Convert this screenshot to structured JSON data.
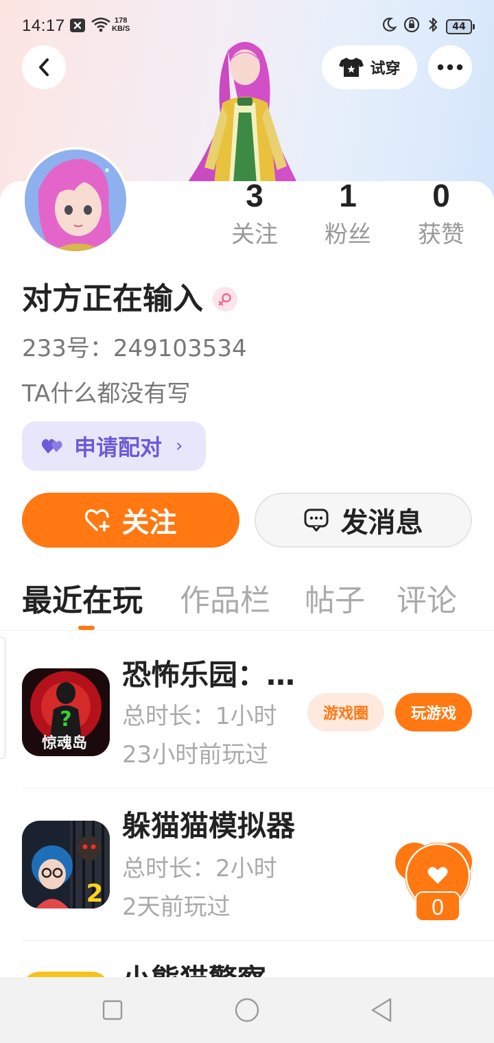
{
  "status_bar": {
    "time": "14:17",
    "speed_value": "178",
    "speed_unit": "KB/S",
    "battery": "44",
    "icons": [
      "close-box-icon",
      "wifi-icon",
      "moon-icon",
      "lock-rotation-icon",
      "bluetooth-icon",
      "battery-icon"
    ]
  },
  "header": {
    "back_icon": "chevron-left-icon",
    "try_on_label": "试穿",
    "try_on_icon": "tshirt-icon",
    "more_icon": "more-dots-icon"
  },
  "profile": {
    "stats": [
      {
        "value": "3",
        "label": "关注"
      },
      {
        "value": "1",
        "label": "粉丝"
      },
      {
        "value": "0",
        "label": "获赞"
      }
    ],
    "username": "对方正在输入",
    "gender_icon": "female-icon",
    "id_line": "233号：249103534",
    "bio": "TA什么都没有写",
    "pair_label": "申请配对",
    "pair_chevron": "›"
  },
  "actions": {
    "follow_label": "关注",
    "message_label": "发消息"
  },
  "tabs": [
    {
      "label": "最近在玩",
      "active": true
    },
    {
      "label": "作品栏",
      "active": false
    },
    {
      "label": "帖子",
      "active": false
    },
    {
      "label": "评论",
      "active": false
    }
  ],
  "games": [
    {
      "title": "恐怖乐园：…",
      "icon_text": "惊魂岛",
      "duration": "总时长：1小时",
      "last_played": "23小时前玩过",
      "circle_label": "游戏圈",
      "play_label": "玩游戏"
    },
    {
      "title": "躲猫猫模拟器",
      "icon_text": "2",
      "duration": "总时长：2小时",
      "last_played": "2天前玩过"
    },
    {
      "title": "小熊猫警察"
    }
  ],
  "like_fab": {
    "count": "0",
    "icon": "heart-icon"
  },
  "colors": {
    "accent": "#ff7811",
    "pair_purple": "#6b5bd6",
    "muted": "#aaaaaa"
  }
}
